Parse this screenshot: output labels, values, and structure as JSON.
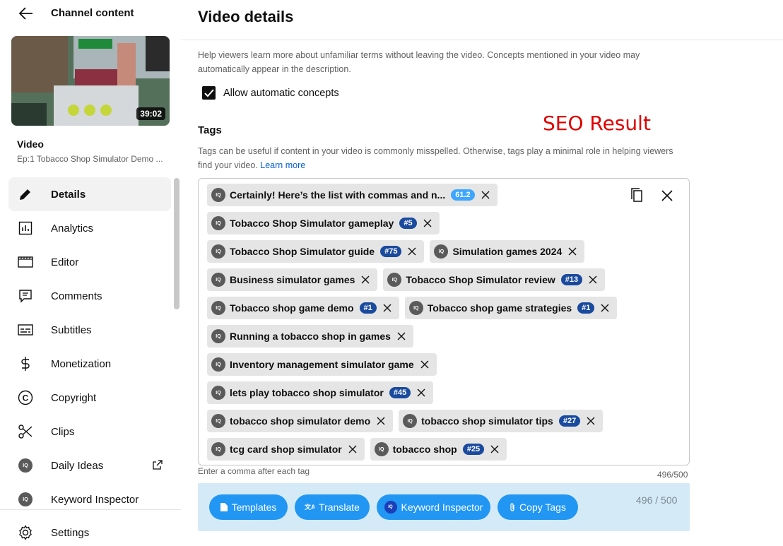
{
  "sidebar": {
    "title": "Channel content",
    "thumbnail_duration": "39:02",
    "video_label": "Video",
    "video_name": "Ep:1 Tobacco Shop Simulator Demo ...",
    "items": [
      {
        "label": "Details",
        "icon": "pencil-icon",
        "active": true
      },
      {
        "label": "Analytics",
        "icon": "analytics-icon"
      },
      {
        "label": "Editor",
        "icon": "editor-icon"
      },
      {
        "label": "Comments",
        "icon": "comments-icon"
      },
      {
        "label": "Subtitles",
        "icon": "subtitles-icon"
      },
      {
        "label": "Monetization",
        "icon": "dollar-icon"
      },
      {
        "label": "Copyright",
        "icon": "copyright-icon"
      },
      {
        "label": "Clips",
        "icon": "scissors-icon"
      },
      {
        "label": "Daily Ideas",
        "icon": "iq-icon"
      },
      {
        "label": "Keyword Inspector",
        "icon": "iq-icon"
      }
    ],
    "settings_label": "Settings"
  },
  "main": {
    "title": "Video details",
    "concepts_desc": "Help viewers learn more about unfamiliar terms without leaving the video. Concepts mentioned in your video may automatically appear in the description.",
    "allow_concepts_label": "Allow automatic concepts",
    "allow_concepts_checked": true,
    "seo_result": "SEO Result",
    "tags_title": "Tags",
    "tags_desc": "Tags can be useful if content in your video is commonly misspelled. Otherwise, tags play a minimal role in helping viewers find your video.",
    "learn_more": "Learn more",
    "tag_rows": [
      [
        {
          "text": "Certainly! Here’s the list with commas and n...",
          "badge": "61.2",
          "score": true
        }
      ],
      [
        {
          "text": "Tobacco Shop Simulator gameplay",
          "badge": "#5"
        }
      ],
      [
        {
          "text": "Tobacco Shop Simulator guide",
          "badge": "#75"
        },
        {
          "text": "Simulation games 2024"
        }
      ],
      [
        {
          "text": "Business simulator games"
        },
        {
          "text": "Tobacco Shop Simulator review",
          "badge": "#13"
        }
      ],
      [
        {
          "text": "Tobacco shop game demo",
          "badge": "#1"
        },
        {
          "text": "Tobacco shop game strategies",
          "badge": "#1"
        }
      ],
      [
        {
          "text": "Running a tobacco shop in games"
        }
      ],
      [
        {
          "text": "Inventory management simulator game"
        }
      ],
      [
        {
          "text": "lets play tobacco shop simulator",
          "badge": "#45"
        }
      ],
      [
        {
          "text": "tobacco shop simulator demo"
        },
        {
          "text": "tobacco shop simulator tips",
          "badge": "#27"
        }
      ],
      [
        {
          "text": "tcg card shop simulator"
        },
        {
          "text": "tobacco shop",
          "badge": "#25"
        }
      ]
    ],
    "hint": "Enter a comma after each tag",
    "counter": "496/500"
  },
  "toolbar": {
    "templates": "Templates",
    "translate": "Translate",
    "keyword_inspector": "Keyword Inspector",
    "copy_tags": "Copy Tags",
    "counter": "496 / 500"
  },
  "colors": {
    "accent_button": "#2196f3",
    "toolbar_bg": "#d4ebf7",
    "rank_badge": "#1a4a9e",
    "score_badge": "#3ea6ff",
    "seo_text": "#e00000"
  }
}
